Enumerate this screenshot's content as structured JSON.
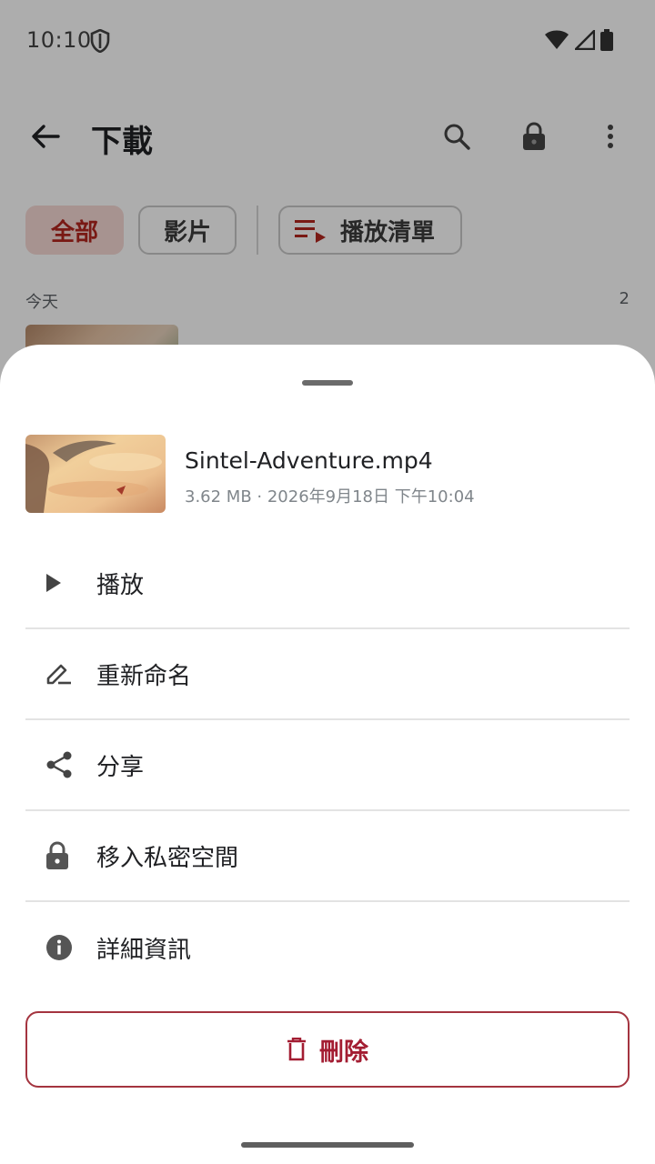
{
  "status": {
    "time": "10:10"
  },
  "app_bar": {
    "title": "下載"
  },
  "chips": {
    "all": "全部",
    "videos": "影片",
    "playlist": "播放清單"
  },
  "section": {
    "label": "今天",
    "count": "2"
  },
  "sheet": {
    "file_name": "Sintel-Adventure.mp4",
    "file_meta": "3.62 MB · 2026年9月18日 下午10:04",
    "menu": [
      {
        "label": "播放",
        "icon": "play-icon"
      },
      {
        "label": "重新命名",
        "icon": "rename-icon"
      },
      {
        "label": "分享",
        "icon": "share-icon"
      },
      {
        "label": "移入私密空間",
        "icon": "lock-icon"
      },
      {
        "label": "詳細資訊",
        "icon": "info-icon"
      }
    ],
    "delete_label": "刪除"
  },
  "colors": {
    "accent": "#b3261e",
    "delete": "#a31d32",
    "chip_selected_bg": "#f6d9d5",
    "scrim": "rgba(0,0,0,0.32)"
  }
}
